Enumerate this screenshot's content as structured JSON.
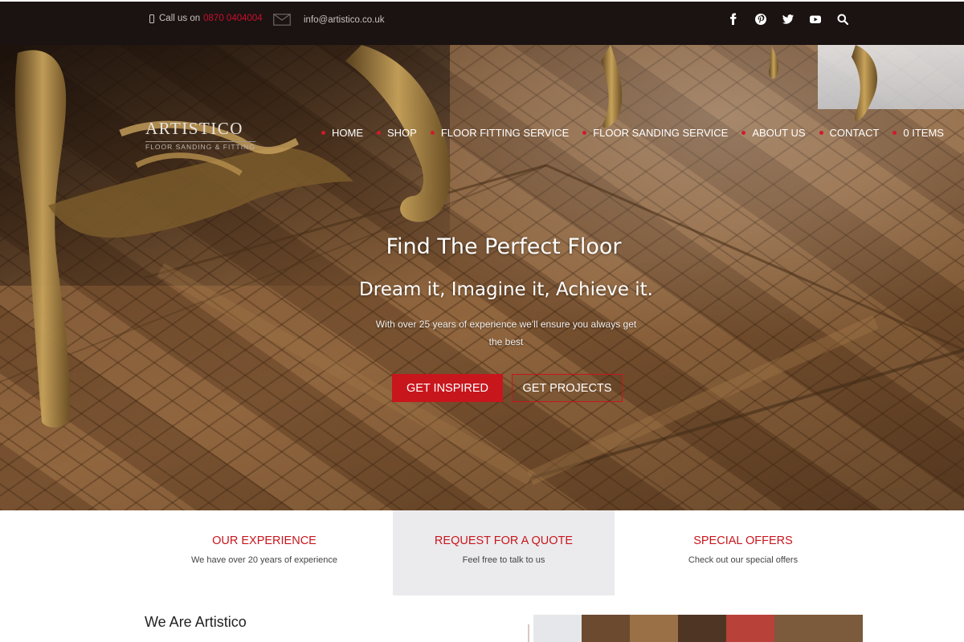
{
  "topbar": {
    "call_prefix": "Call us on",
    "phone": "0870 0404004",
    "email": "info@artistico.co.uk",
    "social_icons": [
      "facebook-icon",
      "pinterest-icon",
      "twitter-icon",
      "youtube-icon",
      "search-icon"
    ]
  },
  "logo": {
    "name": "ARTISTICO",
    "tagline": "FLOOR SANDING & FITTING"
  },
  "nav": {
    "items": [
      "HOME",
      "SHOP",
      "FLOOR FITTING SERVICE",
      "FLOOR SANDING SERVICE",
      "ABOUT US",
      "CONTACT",
      "0 ITEMS"
    ]
  },
  "hero": {
    "title": "Find The Perfect Floor",
    "subtitle": "Dream it, Imagine it, Achieve it.",
    "text": "With over 25 years of experience we'll ensure you always get the best",
    "primary_button": "GET INSPIRED",
    "secondary_button": "GET PROJECTS"
  },
  "features": [
    {
      "title": "OUR EXPERIENCE",
      "desc": "We have over 20 years of experience"
    },
    {
      "title": "REQUEST FOR A QUOTE",
      "desc": "Feel free to talk to us"
    },
    {
      "title": "SPECIAL OFFERS",
      "desc": "Check out our special offers"
    }
  ],
  "about": {
    "title": "We Are Artistico"
  },
  "colors": {
    "accent": "#c8161d",
    "topbar_bg": "#1a1311",
    "highlight_bg": "#ebebed"
  }
}
